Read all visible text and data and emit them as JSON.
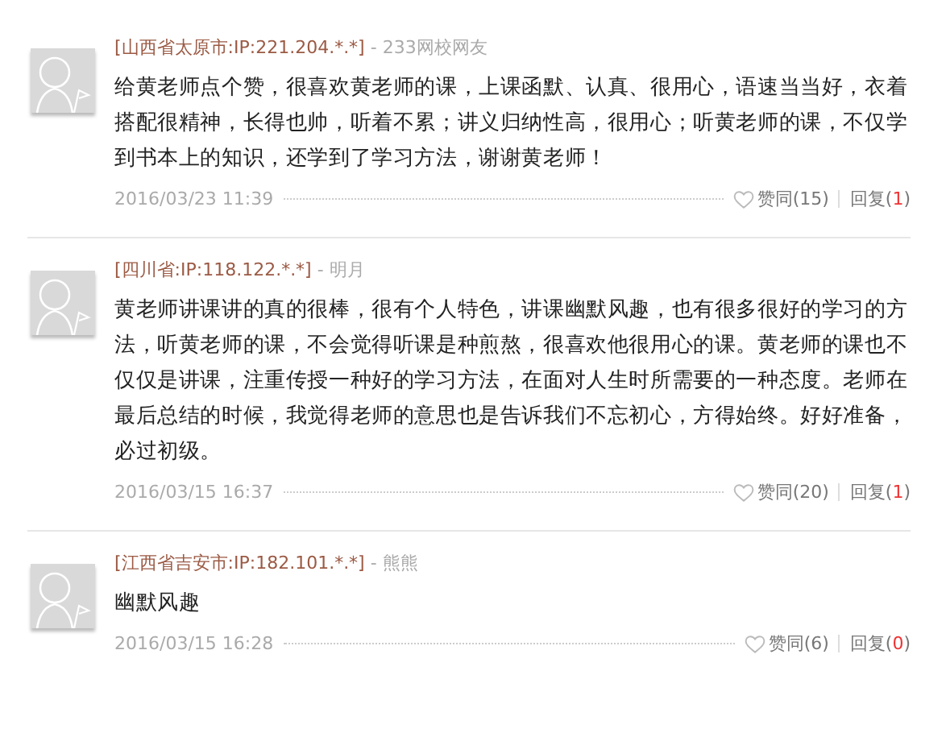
{
  "comments": [
    {
      "location": "[山西省太原市:IP:221.204.*.*]",
      "separator": "-",
      "user": "233网校网友",
      "text": "给黄老师点个赞，很喜欢黄老师的课，上课函默、认真、很用心，语速当当好，衣着搭配很精神，长得也帅，听着不累；讲义归纳性高，很用心；听黄老师的课，不仅学到书本上的知识，还学到了学习方法，谢谢黄老师！",
      "date": "2016/03/23 11:39",
      "likes": "赞同(15)",
      "reply_prefix": "回复(",
      "reply_count": "1",
      "reply_suffix": ")"
    },
    {
      "location": "[四川省:IP:118.122.*.*]",
      "separator": "-",
      "user": "明月",
      "text": "黄老师讲课讲的真的很棒，很有个人特色，讲课幽默风趣，也有很多很好的学习的方法，听黄老师的课，不会觉得听课是种煎熬，很喜欢他很用心的课。黄老师的课也不仅仅是讲课，注重传授一种好的学习方法，在面对人生时所需要的一种态度。老师在最后总结的时候，我觉得老师的意思也是告诉我们不忘初心，方得始终。好好准备，必过初级。",
      "date": "2016/03/15 16:37",
      "likes": "赞同(20)",
      "reply_prefix": "回复(",
      "reply_count": "1",
      "reply_suffix": ")"
    },
    {
      "location": "[江西省吉安市:IP:182.101.*.*]",
      "separator": "-",
      "user": "熊熊",
      "text": "幽默风趣",
      "date": "2016/03/15 16:28",
      "likes": "赞同(6)",
      "reply_prefix": "回复(",
      "reply_count": "0",
      "reply_suffix": ")"
    }
  ]
}
